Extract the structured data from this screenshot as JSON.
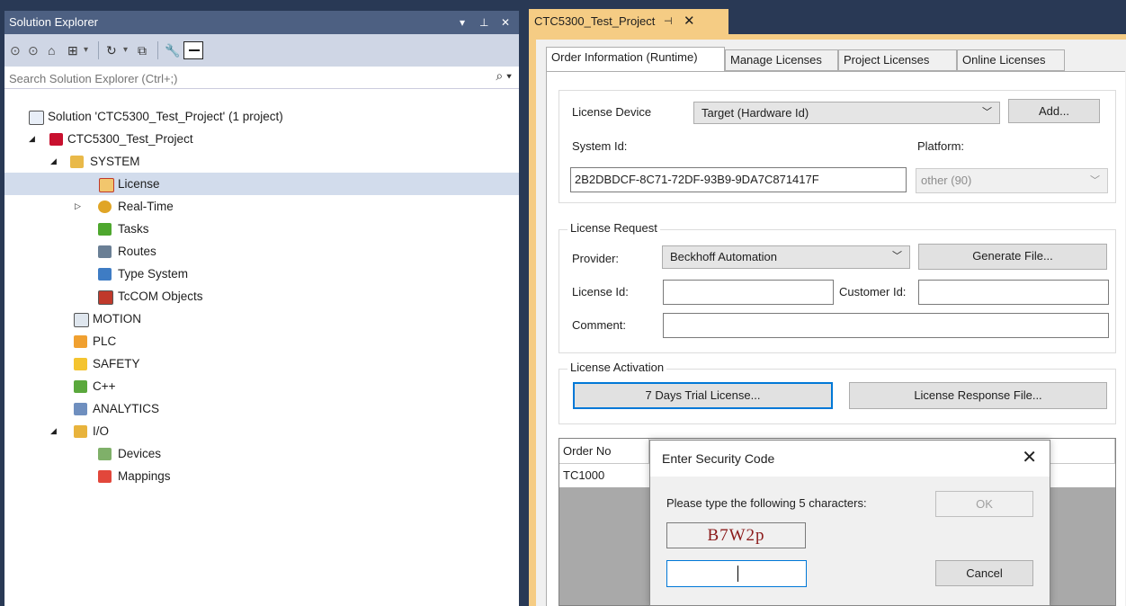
{
  "solution_explorer": {
    "title": "Solution Explorer",
    "title_controls": {
      "dropdown": "▾",
      "pin": "⊥",
      "close": "✕"
    },
    "search_placeholder": "Search Solution Explorer (Ctrl+;)",
    "tree": [
      {
        "label": "Solution 'CTC5300_Test_Project' (1 project)",
        "icon": "solution-icon"
      },
      {
        "label": "CTC5300_Test_Project",
        "icon": "project-icon"
      },
      {
        "label": "SYSTEM",
        "icon": "system-icon"
      },
      {
        "label": "License",
        "icon": "license-icon"
      },
      {
        "label": "Real-Time",
        "icon": "realtime-icon"
      },
      {
        "label": "Tasks",
        "icon": "tasks-icon"
      },
      {
        "label": "Routes",
        "icon": "routes-icon"
      },
      {
        "label": "Type System",
        "icon": "type-system-icon"
      },
      {
        "label": "TcCOM Objects",
        "icon": "tccom-icon"
      },
      {
        "label": "MOTION",
        "icon": "motion-icon"
      },
      {
        "label": "PLC",
        "icon": "plc-icon"
      },
      {
        "label": "SAFETY",
        "icon": "safety-icon"
      },
      {
        "label": "C++",
        "icon": "cpp-icon"
      },
      {
        "label": "ANALYTICS",
        "icon": "analytics-icon"
      },
      {
        "label": "I/O",
        "icon": "io-icon"
      },
      {
        "label": "Devices",
        "icon": "devices-icon"
      },
      {
        "label": "Mappings",
        "icon": "mappings-icon"
      }
    ]
  },
  "document": {
    "tab_title": "CTC5300_Test_Project",
    "tabs": [
      "Order Information (Runtime)",
      "Manage Licenses",
      "Project Licenses",
      "Online Licenses"
    ],
    "license_device": {
      "label": "License Device",
      "selected": "Target (Hardware Id)",
      "add_button": "Add...",
      "system_id_label": "System Id:",
      "system_id_value": "2B2DBDCF-8C71-72DF-93B9-9DA7C871417F",
      "platform_label": "Platform:",
      "platform_value": "other (90)"
    },
    "license_request": {
      "title": "License Request",
      "provider_label": "Provider:",
      "provider_value": "Beckhoff Automation",
      "generate_button": "Generate File...",
      "license_id_label": "License Id:",
      "customer_id_label": "Customer Id:",
      "comment_label": "Comment:"
    },
    "license_activation": {
      "title": "License Activation",
      "trial_button": "7 Days Trial License...",
      "response_button": "License Response File..."
    },
    "grid": {
      "header": "Order No",
      "rows": [
        "TC1000"
      ]
    }
  },
  "dialog": {
    "title": "Enter Security Code",
    "prompt": "Please type the following 5 characters:",
    "captcha": "B7W2p",
    "ok_button": "OK",
    "cancel_button": "Cancel",
    "input_value": ""
  }
}
